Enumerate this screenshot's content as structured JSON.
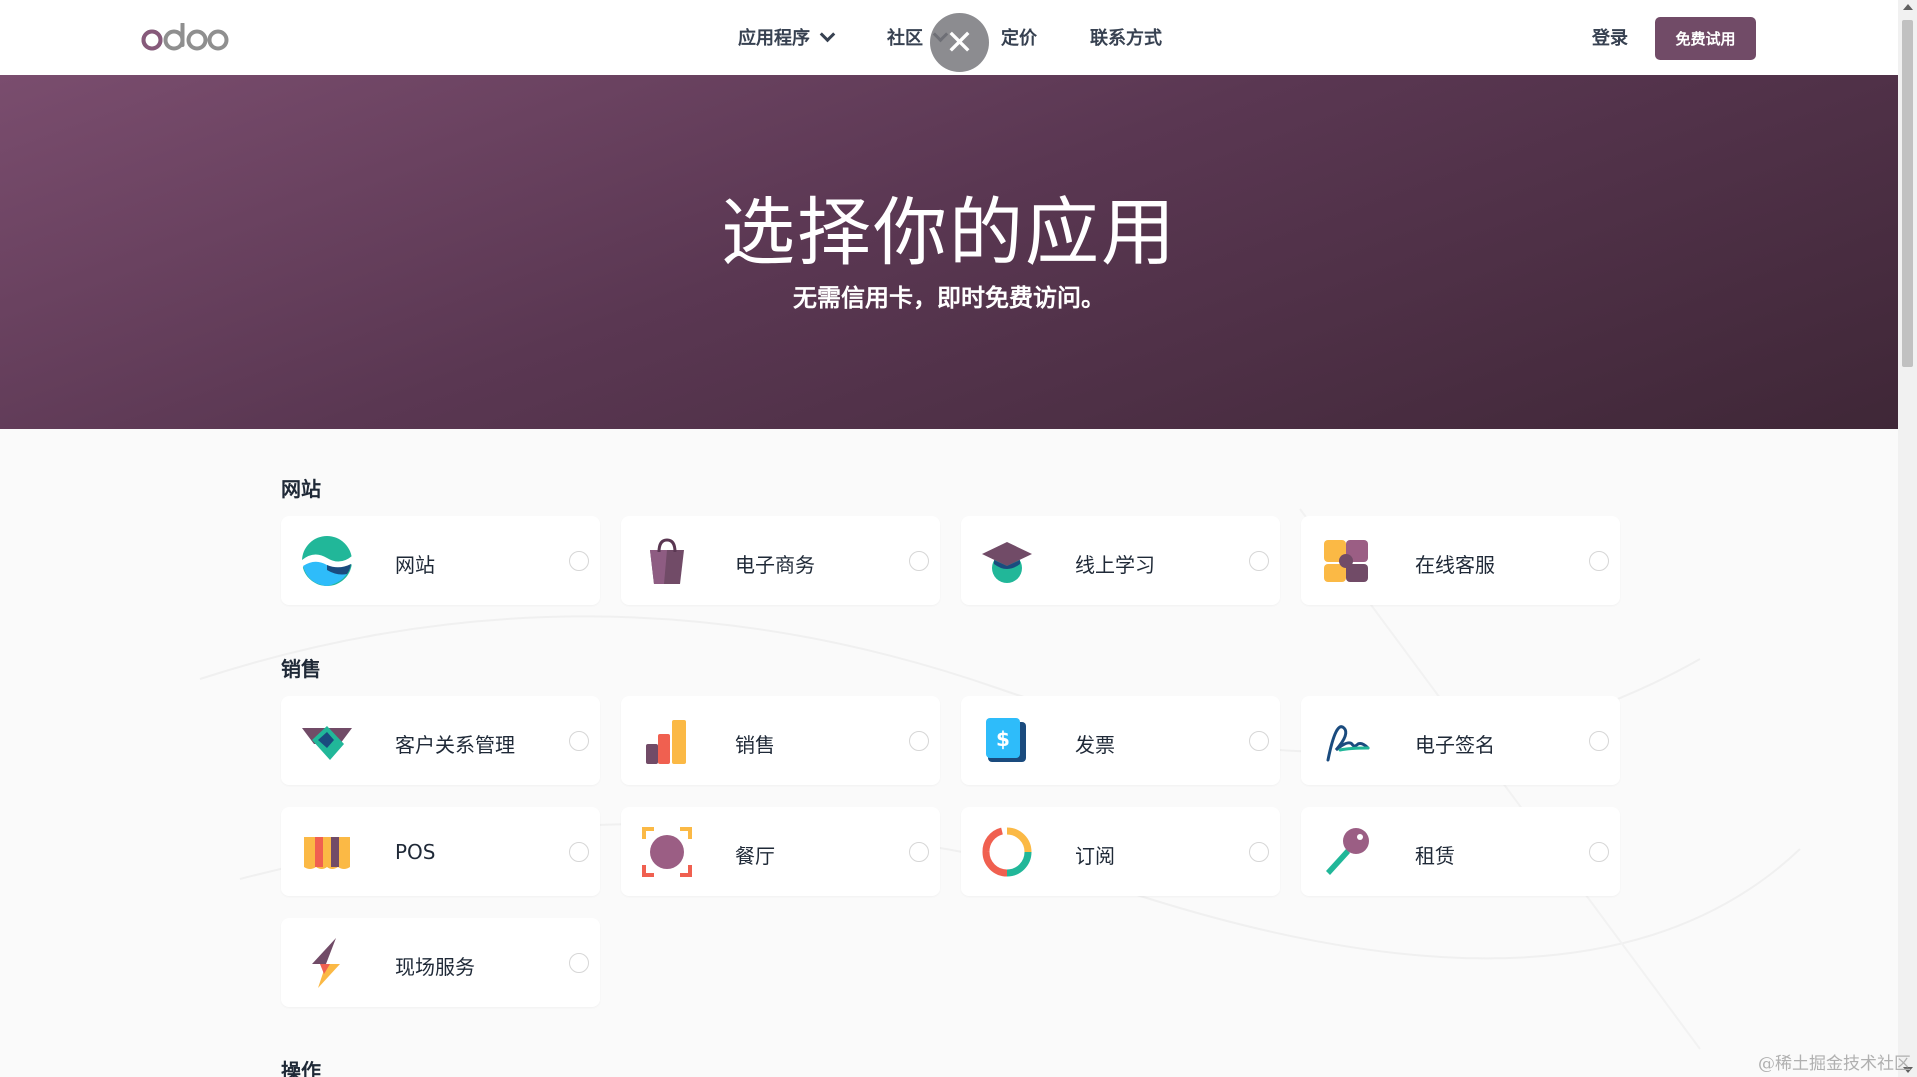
{
  "brand": {
    "logo_text": "odoo",
    "color": "#714b67"
  },
  "nav": {
    "apps": "应用程序",
    "community": "社区",
    "pricing": "定价",
    "contact": "联系方式",
    "close_icon": "close-icon",
    "login": "登录",
    "trial": "免费试用"
  },
  "hero": {
    "title": "选择你的应用",
    "subtitle": "无需信用卡，即时免费访问。"
  },
  "sections": [
    {
      "title": "网站",
      "apps": [
        {
          "label": "网站",
          "icon": "website-icon"
        },
        {
          "label": "电子商务",
          "icon": "ecommerce-icon"
        },
        {
          "label": "线上学习",
          "icon": "elearning-icon"
        },
        {
          "label": "在线客服",
          "icon": "livechat-icon"
        }
      ]
    },
    {
      "title": "销售",
      "apps": [
        {
          "label": "客户关系管理",
          "icon": "crm-icon"
        },
        {
          "label": "销售",
          "icon": "sales-icon"
        },
        {
          "label": "发票",
          "icon": "invoicing-icon"
        },
        {
          "label": "电子签名",
          "icon": "sign-icon"
        },
        {
          "label": "POS",
          "icon": "pos-icon"
        },
        {
          "label": "餐厅",
          "icon": "restaurant-icon"
        },
        {
          "label": "订阅",
          "icon": "subscriptions-icon"
        },
        {
          "label": "租赁",
          "icon": "rental-icon"
        },
        {
          "label": "现场服务",
          "icon": "field-service-icon"
        }
      ]
    },
    {
      "title": "操作",
      "apps": []
    }
  ],
  "watermark": "@稀土掘金技术社区"
}
